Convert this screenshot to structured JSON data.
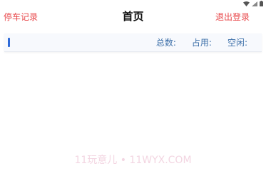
{
  "status_bar": {
    "icons": [
      "wifi-icon",
      "signal-icon",
      "battery-icon"
    ]
  },
  "header": {
    "left_label": "停车记录",
    "title": "首页",
    "right_label": "退出登录"
  },
  "summary": {
    "total_label": "总数:",
    "total_value": "",
    "used_label": "占用:",
    "used_value": "",
    "free_label": "空闲:",
    "free_value": ""
  },
  "watermark": {
    "text": "11玩意儿 • 11WYX.COM"
  },
  "colors": {
    "nav_text": "#e8474a",
    "stat_text": "#3b6ea8",
    "accent_bar": "#2f6bd8",
    "watermark": "#f3d6e2"
  }
}
